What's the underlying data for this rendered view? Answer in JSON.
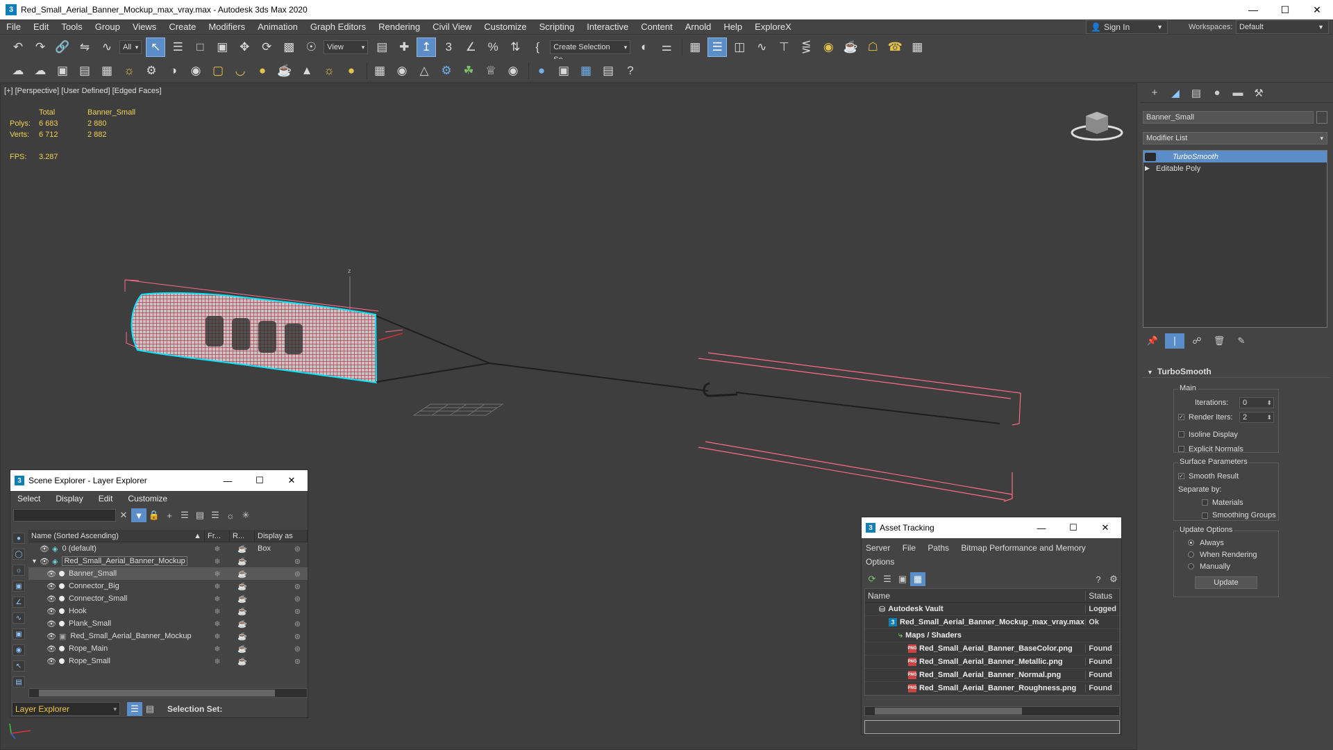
{
  "window": {
    "title": "Red_Small_Aerial_Banner_Mockup_max_vray.max - Autodesk 3ds Max 2020",
    "app_icon": "3"
  },
  "menu": [
    "File",
    "Edit",
    "Tools",
    "Group",
    "Views",
    "Create",
    "Modifiers",
    "Animation",
    "Graph Editors",
    "Rendering",
    "Civil View",
    "Customize",
    "Scripting",
    "Interactive",
    "Content",
    "Arnold",
    "Help",
    "ExploreX"
  ],
  "signin": {
    "label": "Sign In"
  },
  "workspace": {
    "label": "Workspaces:",
    "value": "Default"
  },
  "toolbar": {
    "filter": "All",
    "ref_coord": "View",
    "selection_set": "Create Selection Se"
  },
  "viewport": {
    "label": "[+] [Perspective] [User Defined] [Edged Faces]",
    "stats": {
      "h_total": "Total",
      "h_obj": "Banner_Small",
      "polys_label": "Polys:",
      "polys_total": "6 683",
      "polys_obj": "2 880",
      "verts_label": "Verts:",
      "verts_total": "6 712",
      "verts_obj": "2 882",
      "fps_label": "FPS:",
      "fps": "3.287"
    }
  },
  "scene_explorer": {
    "title": "Scene Explorer - Layer Explorer",
    "menu": [
      "Select",
      "Display",
      "Edit",
      "Customize"
    ],
    "columns": {
      "name": "Name (Sorted Ascending)",
      "sort": "▲",
      "frozen": "Fr...",
      "render": "R...",
      "box": "Display as Box"
    },
    "rows": [
      {
        "name": "0 (default)",
        "level": 0,
        "type": "layer"
      },
      {
        "name": "Red_Small_Aerial_Banner_Mockup",
        "level": 0,
        "type": "layer",
        "expanded": true
      },
      {
        "name": "Banner_Small",
        "level": 1,
        "type": "object",
        "selected": true
      },
      {
        "name": "Connector_Big",
        "level": 1,
        "type": "object"
      },
      {
        "name": "Connector_Small",
        "level": 1,
        "type": "object"
      },
      {
        "name": "Hook",
        "level": 1,
        "type": "object"
      },
      {
        "name": "Plank_Small",
        "level": 1,
        "type": "object"
      },
      {
        "name": "Red_Small_Aerial_Banner_Mockup",
        "level": 1,
        "type": "group"
      },
      {
        "name": "Rope_Main",
        "level": 1,
        "type": "object"
      },
      {
        "name": "Rope_Small",
        "level": 1,
        "type": "object"
      }
    ],
    "footer": {
      "explorer": "Layer Explorer",
      "selection_set": "Selection Set:"
    }
  },
  "command_panel": {
    "object_name": "Banner_Small",
    "modifier_list": "Modifier List",
    "stack": [
      {
        "name": "TurboSmooth",
        "selected": true
      },
      {
        "name": "Editable Poly",
        "selected": false
      }
    ],
    "rollout": {
      "title": "TurboSmooth",
      "main": {
        "label": "Main",
        "iterations_label": "Iterations:",
        "iterations": "0",
        "render_iters_label": "Render Iters:",
        "render_iters": "2",
        "isoline": "Isoline Display",
        "explicit": "Explicit Normals"
      },
      "surface": {
        "label": "Surface Parameters",
        "smooth": "Smooth Result",
        "separate": "Separate by:",
        "materials": "Materials",
        "smoothing": "Smoothing Groups"
      },
      "update": {
        "label": "Update Options",
        "always": "Always",
        "when_rendering": "When Rendering",
        "manually": "Manually",
        "button": "Update"
      }
    }
  },
  "asset_tracking": {
    "title": "Asset Tracking",
    "menu": [
      "Server",
      "File",
      "Paths",
      "Bitmap Performance and Memory"
    ],
    "menu2": "Options",
    "columns": {
      "name": "Name",
      "status": "Status"
    },
    "rows": [
      {
        "name": "Autodesk Vault",
        "status": "Logged",
        "indent": 0
      },
      {
        "name": "Red_Small_Aerial_Banner_Mockup_max_vray.max",
        "status": "Ok",
        "indent": 1
      },
      {
        "name": "Maps / Shaders",
        "status": "",
        "indent": 2
      },
      {
        "name": "Red_Small_Aerial_Banner_BaseColor.png",
        "status": "Found",
        "indent": 3
      },
      {
        "name": "Red_Small_Aerial_Banner_Metallic.png",
        "status": "Found",
        "indent": 3
      },
      {
        "name": "Red_Small_Aerial_Banner_Normal.png",
        "status": "Found",
        "indent": 3
      },
      {
        "name": "Red_Small_Aerial_Banner_Roughness.png",
        "status": "Found",
        "indent": 3
      }
    ]
  },
  "colors": {
    "accent": "#5b8dc9",
    "stats": "#f0d450",
    "selection": "#00e5ff",
    "helper": "#ff6b8a"
  }
}
